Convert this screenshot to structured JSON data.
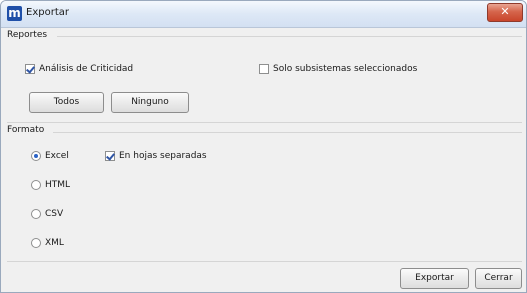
{
  "window": {
    "title": "Exportar",
    "app_icon_letter": "m",
    "close_glyph": "✕"
  },
  "reportes": {
    "title": "Reportes",
    "analisis_label": "Análisis de Criticidad",
    "analisis_checked": true,
    "solo_label": "Solo subsistemas seleccionados",
    "solo_checked": false,
    "todos_label": "Todos",
    "ninguno_label": "Ninguno"
  },
  "formato": {
    "title": "Formato",
    "options": [
      {
        "label": "Excel",
        "selected": true
      },
      {
        "label": "HTML",
        "selected": false
      },
      {
        "label": "CSV",
        "selected": false
      },
      {
        "label": "XML",
        "selected": false
      }
    ],
    "hojas_label": "En hojas separadas",
    "hojas_checked": true
  },
  "footer": {
    "exportar_label": "Exportar",
    "cerrar_label": "Cerrar"
  }
}
